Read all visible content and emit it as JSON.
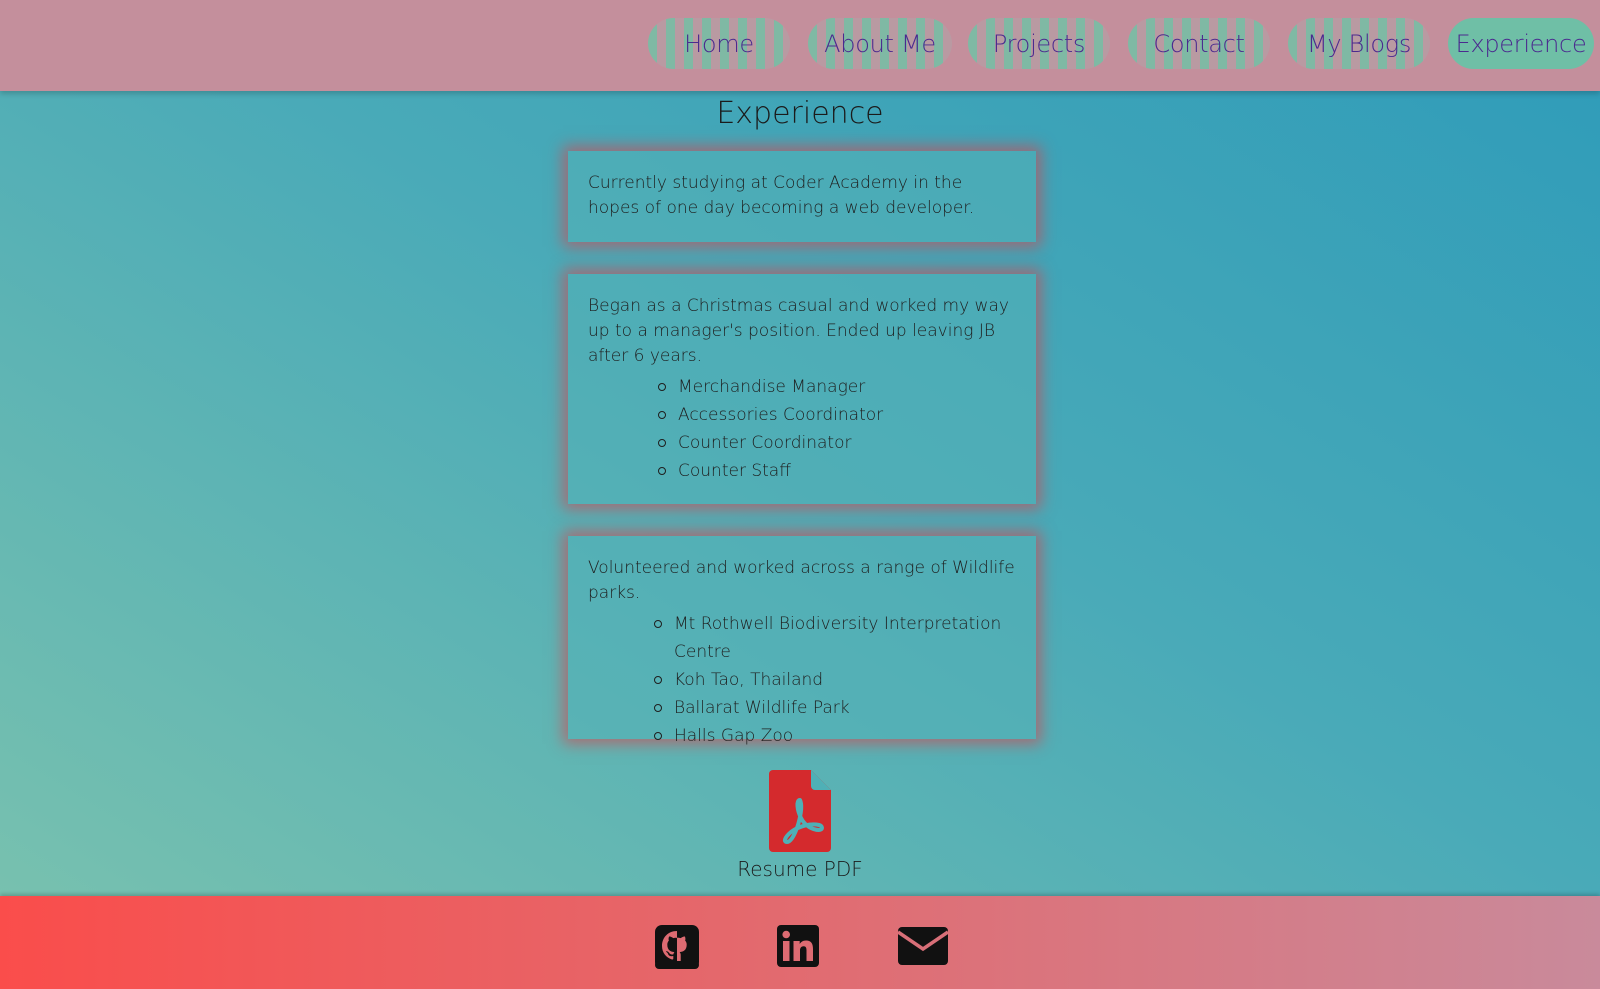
{
  "nav": {
    "items": [
      {
        "label": "Home",
        "active": false
      },
      {
        "label": "About Me",
        "active": false
      },
      {
        "label": "Projects",
        "active": false
      },
      {
        "label": "Contact",
        "active": false
      },
      {
        "label": "My Blogs",
        "active": false
      },
      {
        "label": "Experience",
        "active": true
      }
    ]
  },
  "main": {
    "title": "Experience",
    "cards": [
      {
        "text": "Currently studying at Coder Academy in the hopes of one day becoming a web developer.",
        "items": []
      },
      {
        "text": "Began as a Christmas casual and worked my way up to a manager's position. Ended up leaving JB after 6 years.",
        "items": [
          "Merchandise Manager",
          "Accessories Coordinator",
          "Counter Coordinator",
          "Counter Staff"
        ]
      },
      {
        "text": "Volunteered and worked across a range of Wildlife parks.",
        "items": [
          "Mt Rothwell Biodiversity Interpretation Centre",
          "Koh Tao, Thailand",
          "Ballarat Wildlife Park",
          "Halls Gap Zoo"
        ]
      }
    ],
    "resume": {
      "label": "Resume PDF",
      "icon": "pdf-file-icon"
    }
  },
  "footer": {
    "icons": [
      "github-icon",
      "linkedin-icon",
      "envelope-icon"
    ]
  },
  "colors": {
    "header_bg": "#c48f9c",
    "nav_text": "#4b2a8f",
    "nav_active_bg": "#6fbfa6",
    "pdf_red": "#d42a2d",
    "footer_left": "#fa4d4b",
    "footer_right": "#c98a9b"
  }
}
